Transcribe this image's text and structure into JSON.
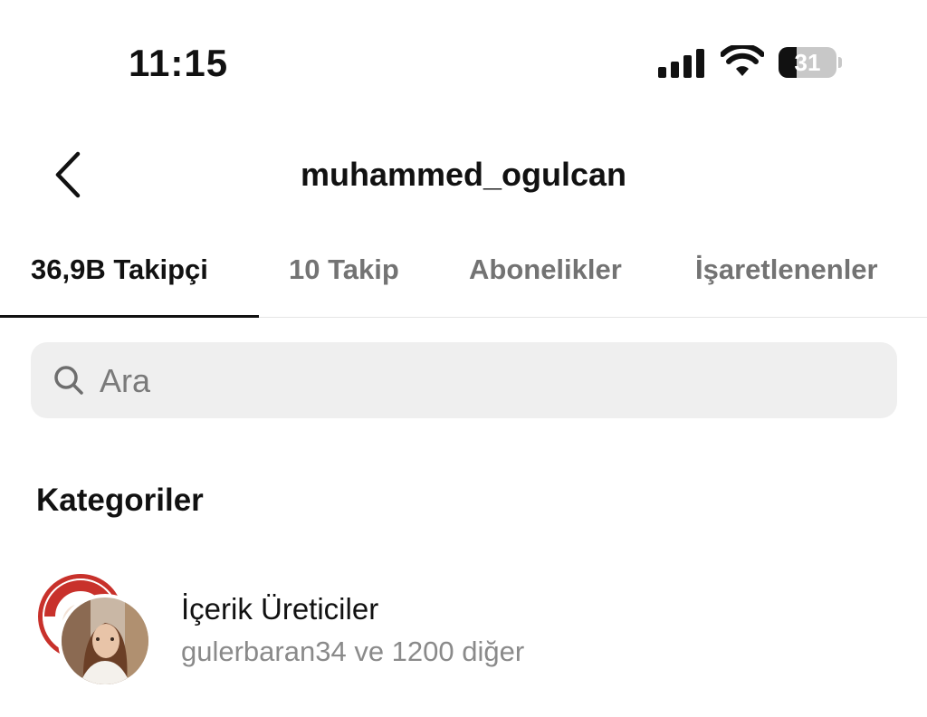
{
  "status_bar": {
    "time": "11:15",
    "battery_level": "31",
    "battery_fraction": 0.31
  },
  "header": {
    "title": "muhammed_ogulcan",
    "back_icon": "chevron-left-icon"
  },
  "tabs": [
    {
      "label": "36,9B Takipçi",
      "active": true
    },
    {
      "label": "10 Takip",
      "active": false
    },
    {
      "label": "Abonelikler",
      "active": false
    },
    {
      "label": "İşaretlenenler",
      "active": false
    }
  ],
  "search": {
    "placeholder": "Ara",
    "value": "",
    "icon": "search-icon"
  },
  "categories": {
    "title": "Kategoriler",
    "items": [
      {
        "name": "İçerik Üreticiler",
        "subtitle": "gulerbaran34 ve 1200 diğer"
      }
    ]
  },
  "colors": {
    "active_text": "#111111",
    "inactive_text": "#737373",
    "search_bg": "#efefef",
    "secondary_text": "#8a8a8a",
    "avatar_ring": "#c8312b"
  }
}
